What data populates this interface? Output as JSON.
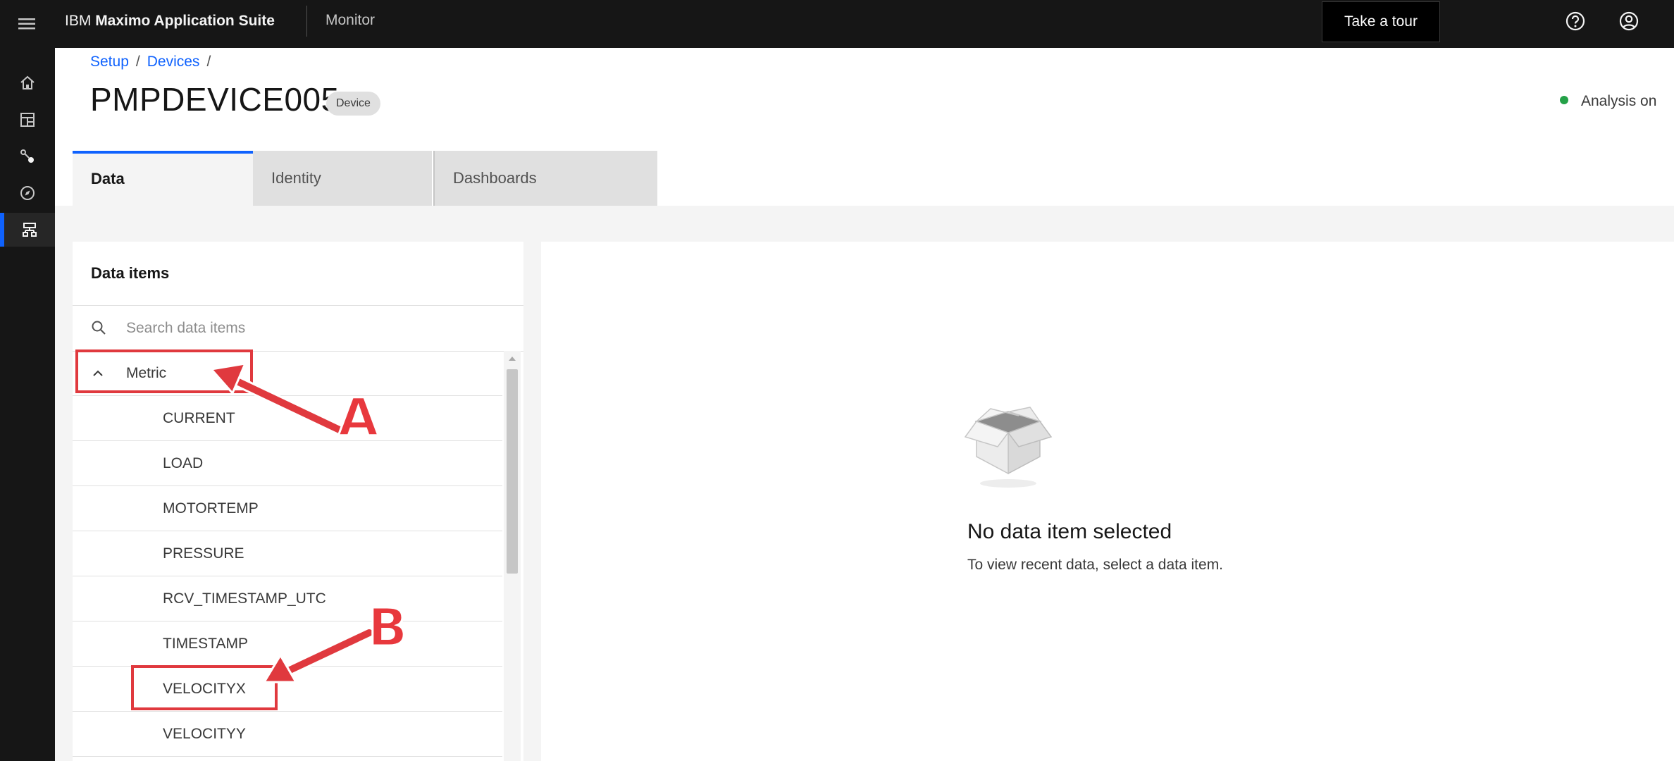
{
  "topbar": {
    "brand_prefix": "IBM",
    "brand_name": "Maximo Application Suite",
    "app_name": "Monitor",
    "tour_label": "Take a tour"
  },
  "breadcrumb": {
    "items": [
      "Setup",
      "Devices"
    ],
    "separator": "/"
  },
  "page": {
    "title": "PMPDEVICE005",
    "tag": "Device",
    "status": "Analysis on",
    "status_color": "#24a148"
  },
  "tabs": [
    {
      "label": "Data"
    },
    {
      "label": "Identity"
    },
    {
      "label": "Dashboards"
    }
  ],
  "data_items": {
    "title": "Data items",
    "search_placeholder": "Search data items",
    "group": "Metric",
    "items": [
      "CURRENT",
      "LOAD",
      "MOTORTEMP",
      "PRESSURE",
      "RCV_TIMESTAMP_UTC",
      "TIMESTAMP",
      "VELOCITYX",
      "VELOCITYY"
    ]
  },
  "empty_state": {
    "title": "No data item selected",
    "subtitle": "To view recent data, select a data item."
  },
  "annotations": {
    "a_label": "A",
    "b_label": "B",
    "color": "#e0393e"
  },
  "colors": {
    "accent": "#0f62fe",
    "topbar": "#161616"
  }
}
